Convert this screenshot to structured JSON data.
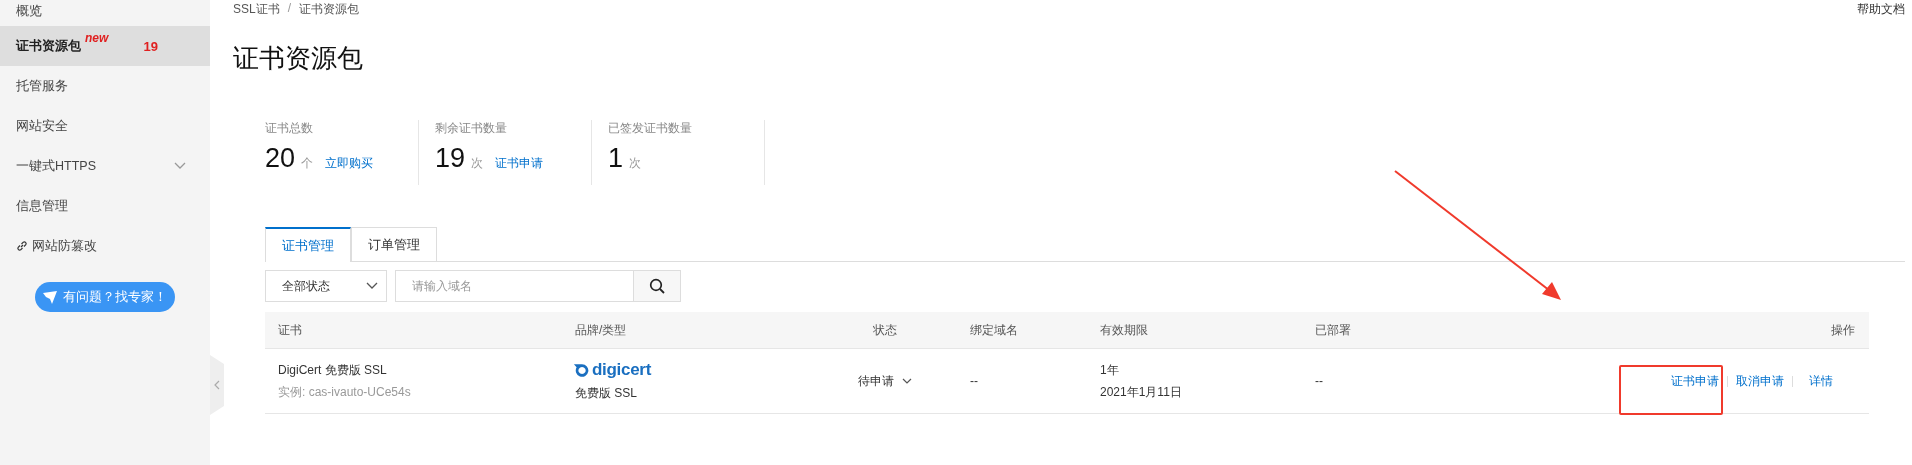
{
  "breadcrumb": [
    "SSL证书",
    "证书资源包"
  ],
  "breadcrumb_separator": "/",
  "help_link": "帮助文档",
  "sidebar": {
    "items": [
      {
        "label": "概览",
        "selected": false,
        "kind": "plain"
      },
      {
        "label": "证书资源包",
        "selected": true,
        "kind": "badge",
        "tag": "new",
        "count": "19"
      },
      {
        "label": "托管服务",
        "selected": false,
        "kind": "plain"
      },
      {
        "label": "网站安全",
        "selected": false,
        "kind": "plain"
      },
      {
        "label": "一键式HTTPS",
        "selected": false,
        "kind": "expandable",
        "expanded": false
      },
      {
        "label": "信息管理",
        "selected": false,
        "kind": "plain"
      },
      {
        "label": "网站防篡改",
        "selected": false,
        "kind": "link"
      }
    ],
    "help_button": "有问题？找专家！"
  },
  "page_title": "证书资源包",
  "stats": [
    {
      "label": "证书总数",
      "value": "20",
      "unit": "个",
      "action": "立即购买"
    },
    {
      "label": "剩余证书数量",
      "value": "19",
      "unit": "次",
      "action": "证书申请"
    },
    {
      "label": "已签发证书数量",
      "value": "1",
      "unit": "次"
    }
  ],
  "tabs": [
    {
      "label": "证书管理",
      "selected": true
    },
    {
      "label": "订单管理",
      "selected": false
    }
  ],
  "filter": {
    "status": "全部状态",
    "search_placeholder": "请输入域名"
  },
  "table": {
    "columns": [
      "证书",
      "品牌/类型",
      "状态",
      "绑定域名",
      "有效期限",
      "已部署",
      "操作"
    ],
    "rows": [
      {
        "name": "DigiCert 免费版 SSL",
        "instance": "实例: cas-ivauto-UCe54s",
        "brand": "digicert",
        "type": "免费版 SSL",
        "status": "待申请",
        "domain": "--",
        "validity": "1年",
        "expiry": "2021年1月11日",
        "deployed": "--",
        "actions": [
          "证书申请",
          "取消申请",
          "详情"
        ]
      }
    ]
  },
  "annotations": {
    "arrow": true,
    "highlight_box": true
  }
}
